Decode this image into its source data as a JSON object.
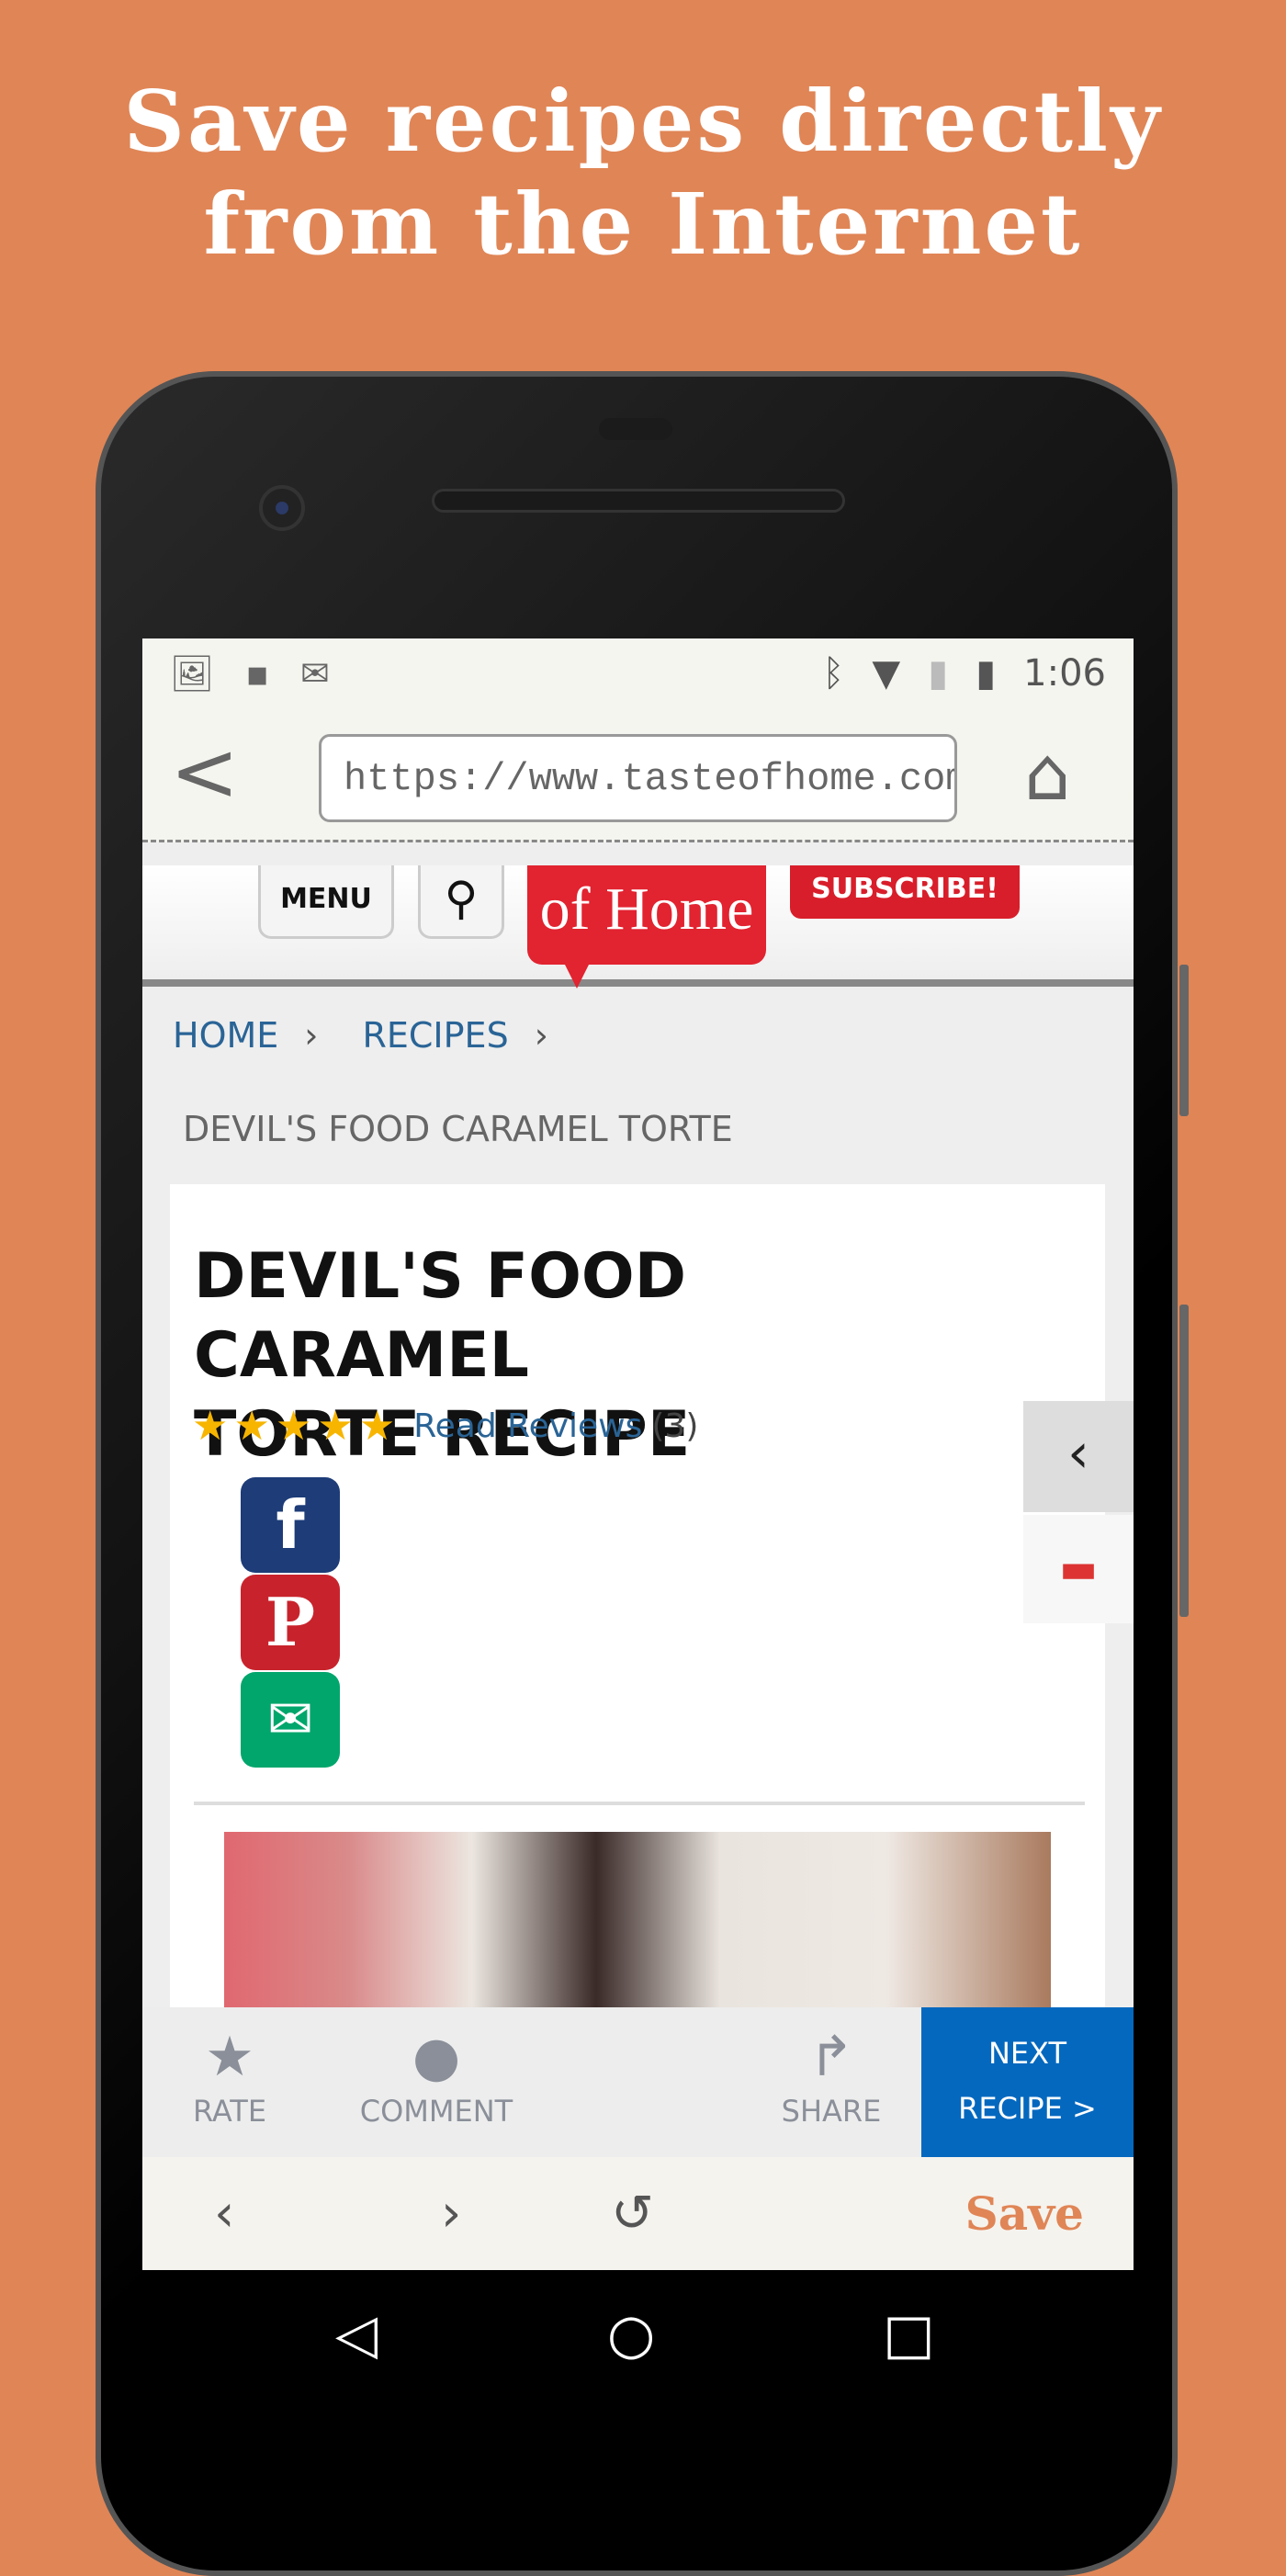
{
  "headline": {
    "line1": "Save recipes directly",
    "line2": "from the Internet"
  },
  "status": {
    "time": "1:06",
    "left_icons": [
      "image-icon",
      "android-icon",
      "gmail-icon"
    ],
    "right_icons": [
      "bluetooth-icon",
      "wifi-icon",
      "no-sim-icon",
      "battery-icon"
    ]
  },
  "browser": {
    "url": "https://www.tasteofhome.com",
    "back_icon": "chevron-left-icon",
    "home_icon": "home-icon"
  },
  "site": {
    "menu_label": "MENU",
    "logo_text": "Taste of Home",
    "subscribe_label": "SUBSCRIBE!"
  },
  "breadcrumb": {
    "items": [
      "HOME",
      "RECIPES"
    ],
    "current": "DEVIL'S FOOD CARAMEL TORTE"
  },
  "recipe": {
    "title_line1": "DEVIL'S FOOD CARAMEL",
    "title_line2": "TORTE RECIPE",
    "stars": 5,
    "reviews_label": "Read Reviews",
    "reviews_count": "(3)"
  },
  "social": [
    {
      "name": "facebook",
      "color": "#1d3c78",
      "glyph": "f"
    },
    {
      "name": "pinterest",
      "color": "#c8232c",
      "glyph": "P"
    },
    {
      "name": "email",
      "color": "#00a66c",
      "glyph": "✉"
    }
  ],
  "actions": {
    "rate": "RATE",
    "comment": "COMMENT",
    "share": "SHARE",
    "next_line1": "NEXT",
    "next_line2": "RECIPE >"
  },
  "toolbar": {
    "save_label": "Save"
  },
  "colors": {
    "background": "#e08556",
    "next_button": "#0468bf",
    "logo_red": "#e22330",
    "star": "#f7b500"
  }
}
